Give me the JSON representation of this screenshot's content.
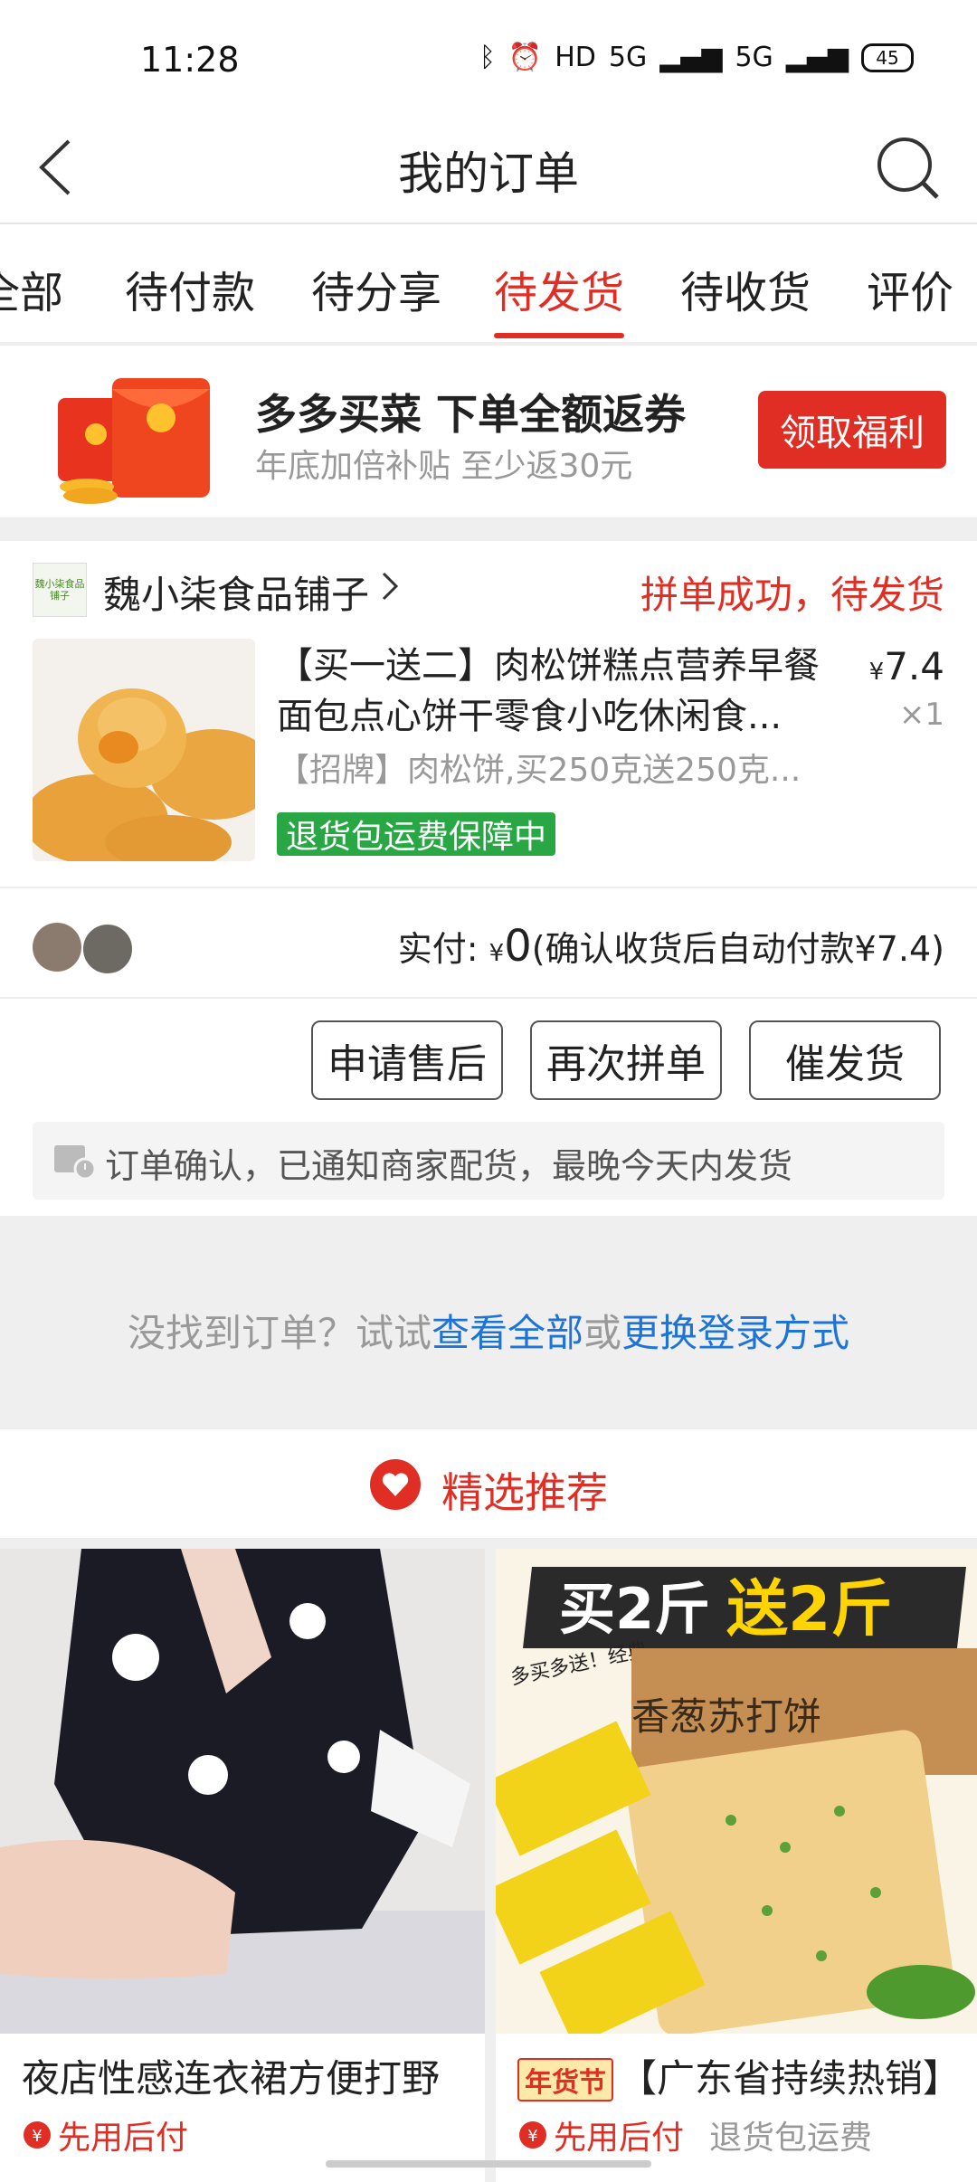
{
  "status_bar": {
    "time": "11:28",
    "network": "HD",
    "signal1": "5G",
    "signal2": "5G",
    "battery": "45"
  },
  "header": {
    "title": "我的订单"
  },
  "tabs": [
    "全部",
    "待付款",
    "待分享",
    "待发货",
    "待收货",
    "评价"
  ],
  "active_tab": "待发货",
  "banner": {
    "headline": "多多买菜 下单全额返券",
    "subline": "年底加倍补贴 至少返30元",
    "button": "领取福利"
  },
  "order": {
    "shop_logo_text": "魏小柒食品铺子",
    "shop_name": "魏小柒食品铺子",
    "status": "拼单成功，待发货",
    "product_title": "【买一送二】肉松饼糕点营养早餐面包点心饼干零食小吃休闲食...",
    "price_symbol": "¥",
    "price": "7.4",
    "quantity": "×1",
    "spec": "【招牌】肉松饼,买250克送250克...",
    "badge": "退货包运费保障中",
    "paid_label": "实付:",
    "paid_symbol": "¥",
    "paid_amount": "0",
    "paid_note": "(确认收货后自动付款¥7.4)",
    "actions": [
      "申请售后",
      "再次拼单",
      "催发货"
    ],
    "notice": "订单确认，已通知商家配货，最晚今天内发货"
  },
  "not_found": {
    "prefix": "没找到订单？试试",
    "link1": "查看全部",
    "or": "或",
    "link2": "更换登录方式"
  },
  "recommend": {
    "title": "精选推荐"
  },
  "grid": [
    {
      "title": "夜店性感连衣裙方便打野",
      "tag": "先用后付",
      "extra": ""
    },
    {
      "badge": "年货节",
      "title": "【广东省持续热销】",
      "tag": "先用后付",
      "extra": "退货包运费",
      "promo_top": "买2斤",
      "promo_red": "送2斤",
      "promo_small": "多买多送！经典",
      "box_text": "香葱苏打饼"
    }
  ],
  "colors": {
    "accent": "#e02e24",
    "green_badge": "#2aa745",
    "link": "#1e74d6"
  }
}
